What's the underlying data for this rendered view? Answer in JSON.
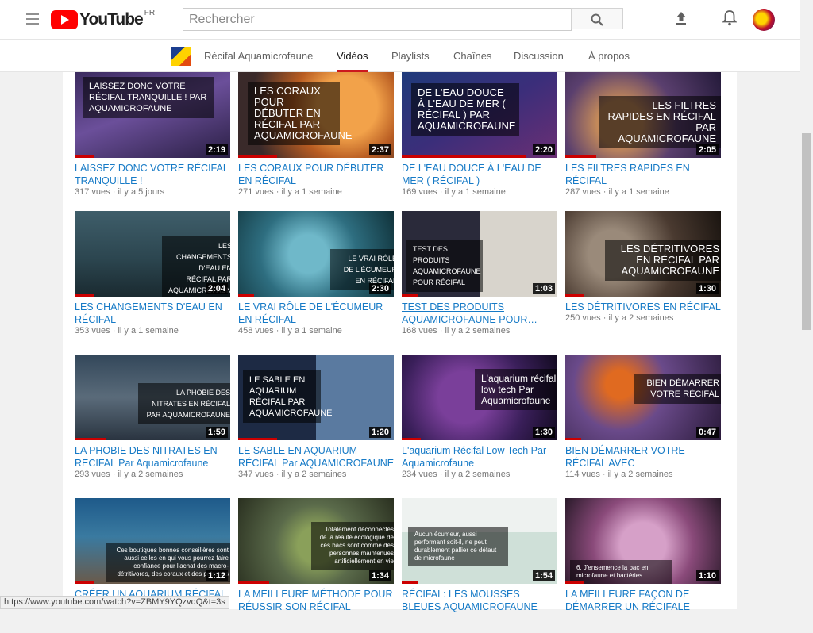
{
  "logo": {
    "word": "YouTube",
    "country": "FR"
  },
  "search": {
    "placeholder": "Rechercher"
  },
  "channel": {
    "name": "Récifal Aquamicrofaune"
  },
  "tabs": [
    {
      "label": "Vidéos",
      "active": true
    },
    {
      "label": "Playlists"
    },
    {
      "label": "Chaînes"
    },
    {
      "label": "Discussion"
    },
    {
      "label": "À propos"
    }
  ],
  "videos": [
    {
      "thumb_text": "LAISSEZ DONC VOTRE RÉCIFAL TRANQUILLE ! Par Aquamicrofaune",
      "duration": "2:19",
      "progress": 0.12,
      "title": "LAISSEZ DONC VOTRE RÉCIFAL TRANQUILLE !",
      "views": "317 vues",
      "age": "il y a 5 jours"
    },
    {
      "thumb_text": "LES CORAUX POUR DÉBUTER EN RÉCIFAL Par Aquamicrofaune",
      "duration": "2:37",
      "progress": 0.25,
      "title": "LES CORAUX POUR DÉBUTER EN RÉCIFAL",
      "views": "271 vues",
      "age": "il y a 1 semaine"
    },
    {
      "thumb_text": "DE L'EAU DOUCE À L'EAU DE MER ( RÉCIFAL ) Par Aquamicrofaune",
      "duration": "2:20",
      "progress": 0.8,
      "title": "DE L'EAU DOUCE À L'EAU DE MER ( RÉCIFAL )",
      "views": "169 vues",
      "age": "il y a 1 semaine"
    },
    {
      "thumb_text": "LES FILTRES RAPIDES EN RÉCIFAL Par Aquamicrofaune",
      "duration": "2:05",
      "progress": 0.2,
      "title": "LES FILTRES RAPIDES EN RÉCIFAL",
      "views": "287 vues",
      "age": "il y a 1 semaine"
    },
    {
      "thumb_text": "LES CHANGEMENTS D'EAU EN RÉCIFAL Par Aquamicrofaune",
      "duration": "2:04",
      "progress": 0.12,
      "title": "LES CHANGEMENTS D'EAU EN RÉCIFAL",
      "views": "353 vues",
      "age": "il y a 1 semaine"
    },
    {
      "thumb_text": "LE VRAI RÔLE DE L'ÉCUMEUR EN RÉCIFAL",
      "duration": "2:30",
      "progress": 0.1,
      "title": "LE VRAI RÔLE DE L'ÉCUMEUR EN RÉCIFAL",
      "views": "458 vues",
      "age": "il y a 1 semaine"
    },
    {
      "thumb_text": "TEST DES PRODUITS AQUAMICROFAUNE POUR RÉCIFAL",
      "duration": "1:03",
      "progress": 0.1,
      "title": "TEST DES PRODUITS AQUAMICROFAUNE POUR…",
      "views": "168 vues",
      "age": "il y a 2 semaines"
    },
    {
      "thumb_text": "LES DÉTRITIVORES EN RÉCIFAL Par AQUAMICROFAUNE",
      "duration": "1:30",
      "progress": 0.12,
      "title": "LES DÉTRITIVORES EN RÉCIFAL",
      "views": "250 vues",
      "age": "il y a 2 semaines"
    },
    {
      "thumb_text": "LA PHOBIE DES NITRATES EN RÉCIFAL Par Aquamicrofaune",
      "duration": "1:59",
      "progress": 0.2,
      "title": "LA PHOBIE DES NITRATES EN RECIFAL Par Aquamicrofaune",
      "views": "293 vues",
      "age": "il y a 2 semaines"
    },
    {
      "thumb_text": "LE SABLE EN AQUARIUM RÉCIFAL Par AQUAMICROFAUNE",
      "duration": "1:20",
      "progress": 0.25,
      "title": "LE SABLE EN AQUARIUM RÉCIFAL Par AQUAMICROFAUNE",
      "views": "347 vues",
      "age": "il y a 2 semaines"
    },
    {
      "thumb_text": "L'aquarium récifal low tech Par Aquamicrofaune",
      "duration": "1:30",
      "progress": 0.12,
      "title": "L'aquarium Récifal Low Tech Par Aquamicrofaune",
      "views": "234 vues",
      "age": "il y a 2 semaines"
    },
    {
      "thumb_text": "BIEN DÉMARRER VOTRE RÉCIFAL",
      "duration": "0:47",
      "progress": 0.1,
      "title": "BIEN DÉMARRER VOTRE RÉCIFAL AVEC AQUAMICROFAUNE",
      "views": "114 vues",
      "age": "il y a 2 semaines"
    },
    {
      "thumb_text": "Ces boutiques bonnes conseillères sont aussi celles en qui vous pourrez faire confiance pour l'achat des macro-détritivores, des coraux et des poissons",
      "duration": "1:12",
      "progress": 0.12,
      "title": "CRÉER UN AQUARIUM RÉCIFAL",
      "views": "",
      "age": ""
    },
    {
      "thumb_text": "Totalement déconnectés de la réalité écologique de ces bacs sont comme des personnes maintenues artificiellement en vie",
      "duration": "1:34",
      "progress": 0.2,
      "title": "LA MEILLEURE MÉTHODE POUR RÉUSSIR SON RÉCIFAL",
      "views": "",
      "age": ""
    },
    {
      "thumb_text": "Aucun écumeur, aussi performant soit-il, ne peut durablement pallier ce défaut de microfaune",
      "duration": "1:54",
      "progress": 0.1,
      "title": "RÉCIFAL: LES MOUSSES BLEUES AQUAMICROFAUNE",
      "views": "",
      "age": ""
    },
    {
      "thumb_text": "6. J'ensemence la bac en microfaune et bactéries",
      "duration": "1:10",
      "progress": 0.12,
      "title": "LA MEILLEURE FAÇON DE DÉMARRER UN RÉCIFALE",
      "views": "",
      "age": ""
    }
  ],
  "status_url": "https://www.youtube.com/watch?v=ZBMY9YQzvdQ&t=3s"
}
